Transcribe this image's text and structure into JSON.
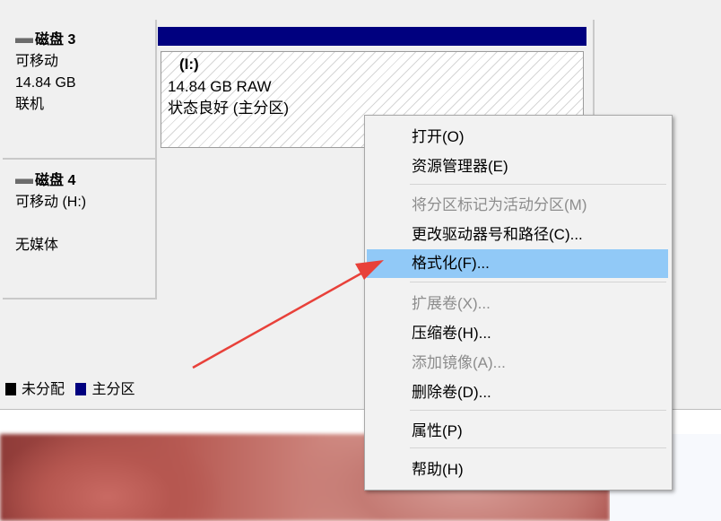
{
  "disks": [
    {
      "name": "磁盘 3",
      "type": "可移动",
      "size": "14.84 GB",
      "status": "联机",
      "partition": {
        "label": "(I:)",
        "size_fs": "14.84 GB RAW",
        "status": "状态良好 (主分区)"
      }
    },
    {
      "name": "磁盘 4",
      "type": "可移动 (H:)",
      "media": "无媒体"
    }
  ],
  "legend": [
    {
      "label": "未分配",
      "color": "#000000"
    },
    {
      "label": "主分区",
      "color": "#00007f"
    }
  ],
  "context_menu": {
    "items": [
      {
        "label": "打开(O)",
        "enabled": true
      },
      {
        "label": "资源管理器(E)",
        "enabled": true
      },
      {
        "label": "将分区标记为活动分区(M)",
        "enabled": false
      },
      {
        "label": "更改驱动器号和路径(C)...",
        "enabled": true
      },
      {
        "label": "格式化(F)...",
        "enabled": true,
        "highlighted": true
      },
      {
        "label": "扩展卷(X)...",
        "enabled": false
      },
      {
        "label": "压缩卷(H)...",
        "enabled": true
      },
      {
        "label": "添加镜像(A)...",
        "enabled": false
      },
      {
        "label": "删除卷(D)...",
        "enabled": true
      },
      {
        "label": "属性(P)",
        "enabled": true
      },
      {
        "label": "帮助(H)",
        "enabled": true
      }
    ]
  },
  "colors": {
    "primary_partition": "#00007f",
    "highlight": "#91c9f7",
    "arrow": "#e8413a"
  }
}
